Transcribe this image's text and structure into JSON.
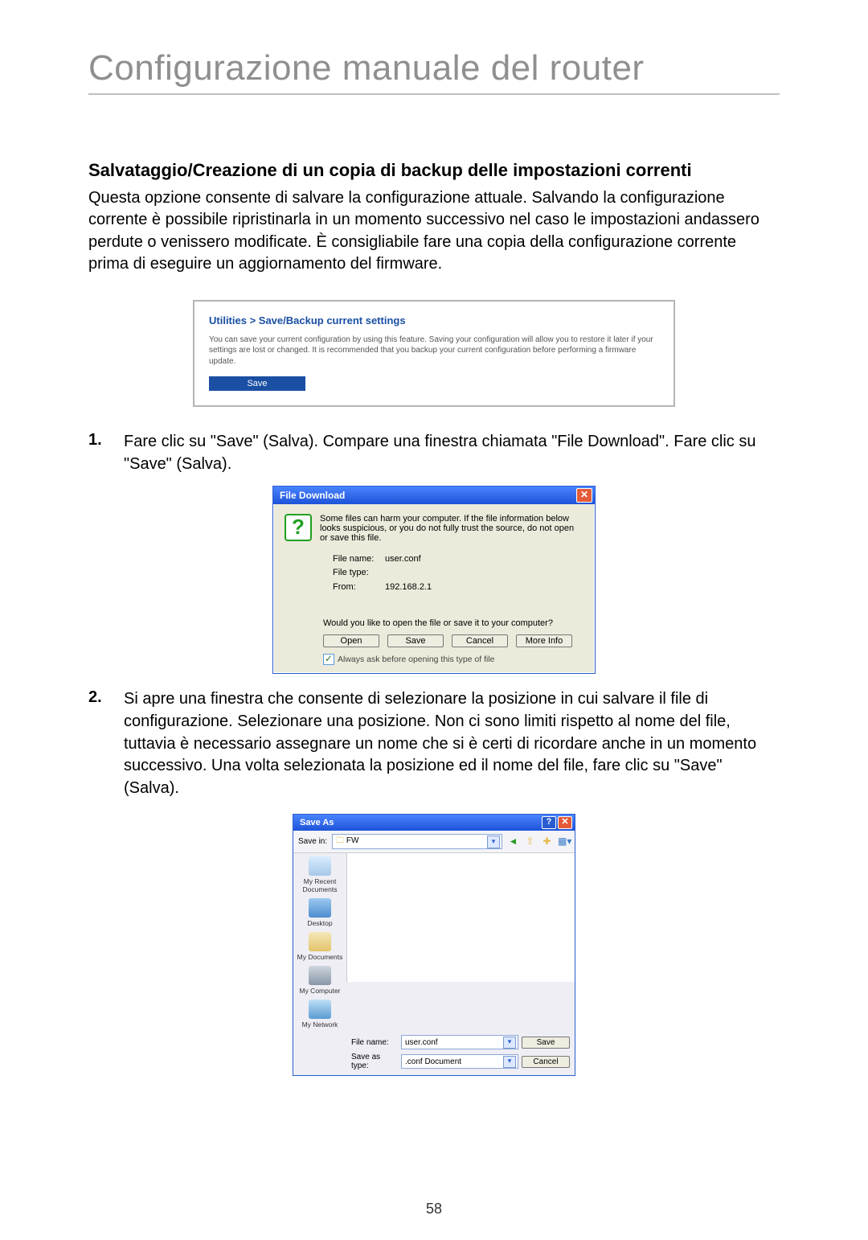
{
  "page": {
    "title": "Configurazione manuale del router",
    "page_number": "58"
  },
  "section": {
    "heading": "Salvataggio/Creazione di un copia di backup delle impostazioni correnti",
    "body": "Questa opzione consente di salvare la configurazione attuale. Salvando la configurazione corrente è possibile ripristinarla in un momento successivo nel caso le impostazioni andassero perdute o venissero modificate. È consigliabile fare una copia della configurazione corrente prima di eseguire un aggiornamento del firmware."
  },
  "panel1": {
    "breadcrumb": "Utilities > Save/Backup current settings",
    "description": "You can save your current configuration by using this feature. Saving your configuration will allow you to restore it later if your settings are lost or changed. It is recommended that you backup your current configuration before performing a firmware update.",
    "save_label": "Save"
  },
  "step1": {
    "num": "1.",
    "text": "Fare clic su \"Save\" (Salva). Compare una finestra chiamata \"File Download\". Fare clic su \"Save\" (Salva)."
  },
  "file_download": {
    "title": "File Download",
    "warning": "Some files can harm your computer. If the file information below looks suspicious, or you do not fully trust the source, do not open or save this file.",
    "file_name_label": "File name:",
    "file_name_value": "user.conf",
    "file_type_label": "File type:",
    "file_type_value": "",
    "from_label": "From:",
    "from_value": "192.168.2.1",
    "question": "Would you like to open the file or save it to your computer?",
    "buttons": {
      "open": "Open",
      "save": "Save",
      "cancel": "Cancel",
      "more": "More Info"
    },
    "checkbox_label": "Always ask before opening this type of file"
  },
  "step2": {
    "num": "2.",
    "text": "Si apre una finestra che consente di selezionare la posizione in cui salvare il file di configurazione. Selezionare una posizione. Non ci sono limiti rispetto al nome del file, tuttavia è necessario assegnare un nome che si è certi di ricordare anche in un momento successivo. Una volta selezionata la posizione ed il nome del file, fare clic su \"Save\" (Salva)."
  },
  "save_as": {
    "title": "Save As",
    "save_in_label": "Save in:",
    "save_in_value": "FW",
    "sidebar": {
      "recent": "My Recent Documents",
      "desktop": "Desktop",
      "mydocs": "My Documents",
      "mycomp": "My Computer",
      "mynet": "My Network"
    },
    "file_name_label": "File name:",
    "file_name_value": "user.conf",
    "save_type_label": "Save as type:",
    "save_type_value": ".conf Document",
    "save_btn": "Save",
    "cancel_btn": "Cancel"
  }
}
